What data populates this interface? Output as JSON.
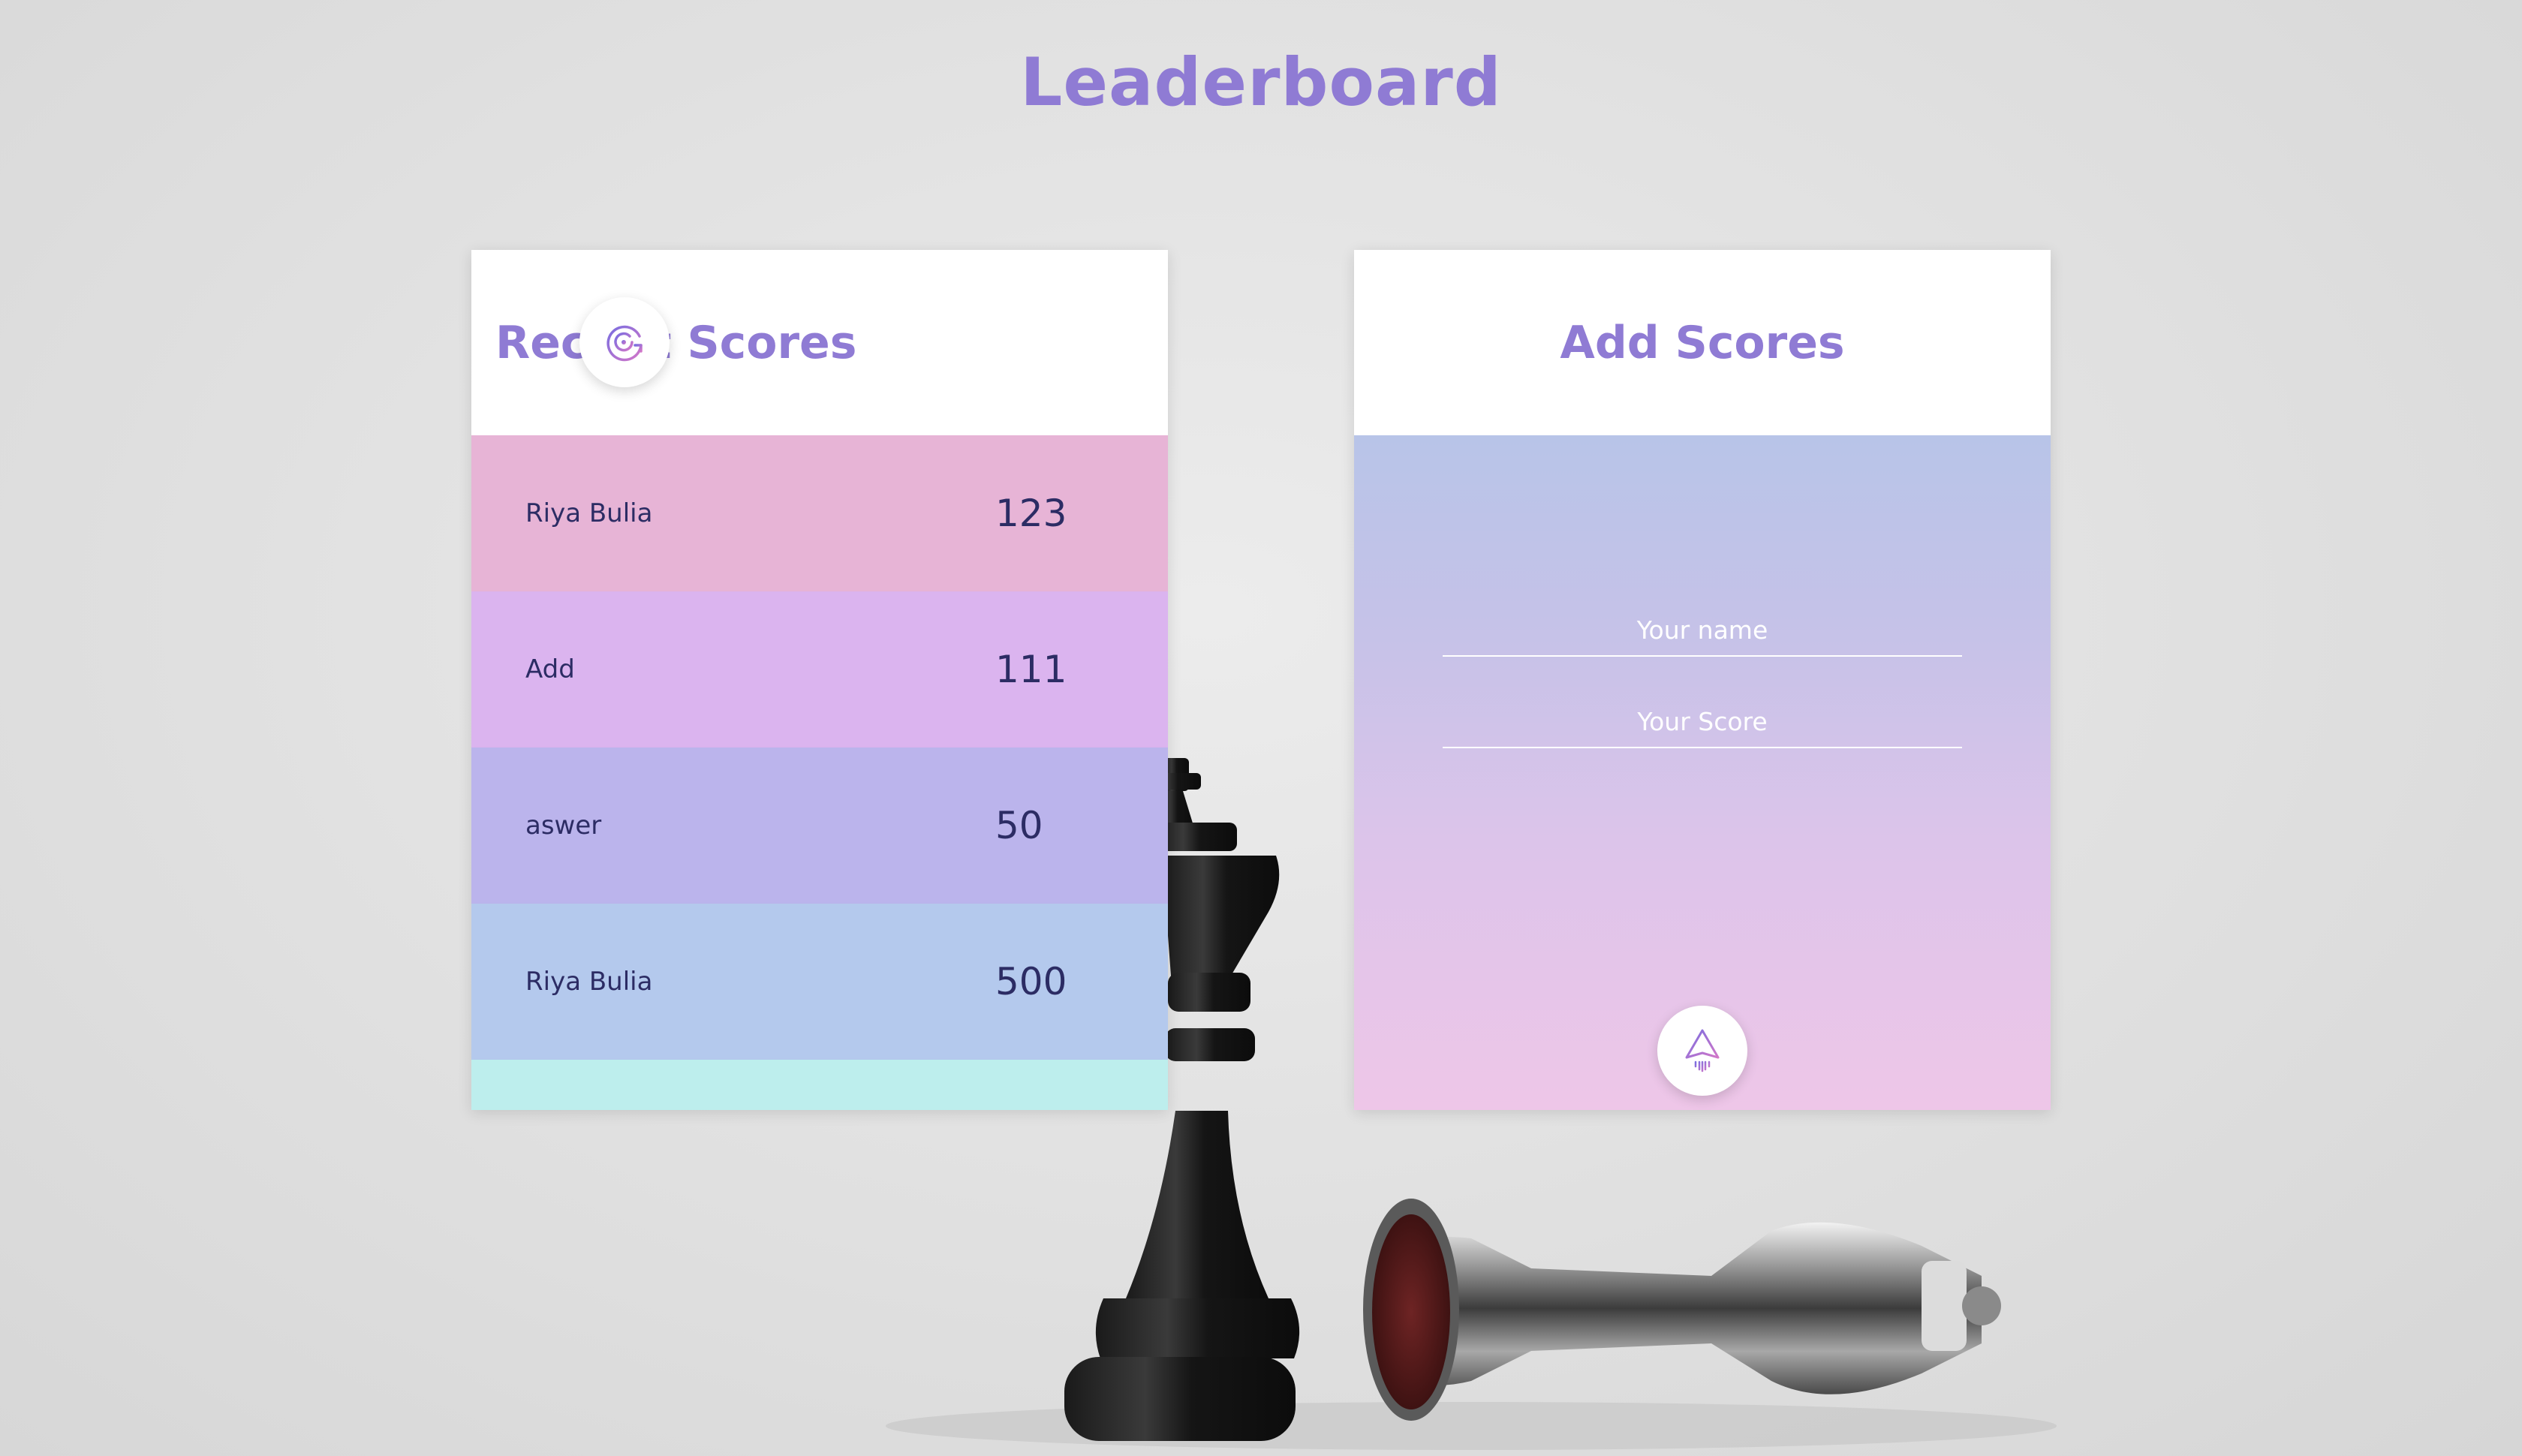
{
  "page": {
    "title": "Leaderboard"
  },
  "recent_scores": {
    "title": "Recent Scores",
    "refresh_icon": "refresh-icon",
    "rows": [
      {
        "name": "Riya Bulia",
        "score": "123",
        "color": "#e7b4d6"
      },
      {
        "name": "Add",
        "score": "111",
        "color": "#dbb4ef"
      },
      {
        "name": "aswer",
        "score": "50",
        "color": "#bbb4ec"
      },
      {
        "name": "Riya Bulia",
        "score": "500",
        "color": "#b4c9ed"
      },
      {
        "name": "",
        "score": "",
        "color": "#bdeeed"
      }
    ]
  },
  "add_scores": {
    "title": "Add Scores",
    "name_placeholder": "Your name",
    "score_placeholder": "Your Score",
    "submit_icon": "paper-plane-icon"
  },
  "colors": {
    "accent": "#8f7bd4",
    "row_text": "#2c2c64"
  }
}
